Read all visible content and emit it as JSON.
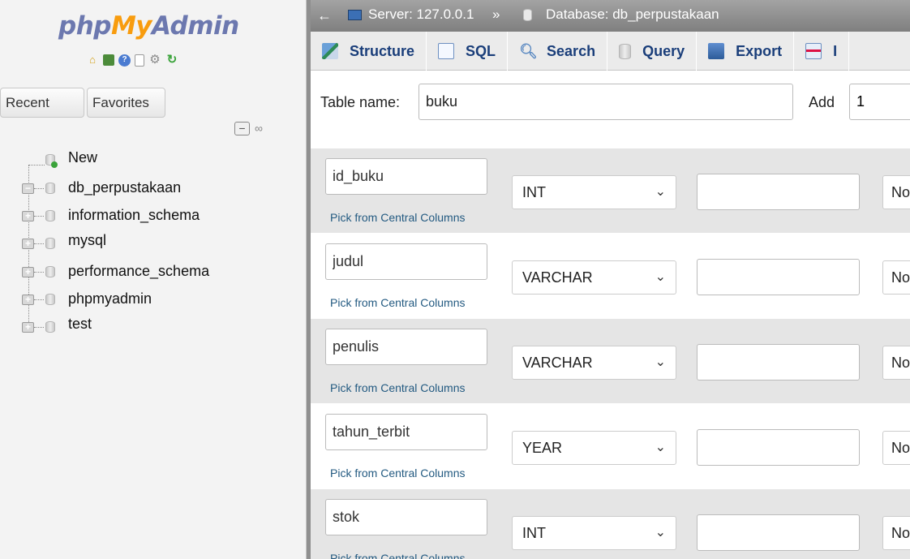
{
  "nav": {
    "logo": {
      "php": "php",
      "my": "My",
      "admin": "Admin"
    },
    "recent_label": "Recent",
    "favorites_label": "Favorites",
    "tree": [
      {
        "label": "New",
        "type": "new"
      },
      {
        "label": "db_perpustakaan",
        "type": "expanded"
      },
      {
        "label": "information_schema",
        "type": "collapsed"
      },
      {
        "label": "mysql",
        "type": "collapsed"
      },
      {
        "label": "performance_schema",
        "type": "collapsed"
      },
      {
        "label": "phpmyadmin",
        "type": "collapsed"
      },
      {
        "label": "test",
        "type": "collapsed"
      }
    ]
  },
  "breadcrumb": {
    "back": "←",
    "server": "Server: 127.0.0.1",
    "separator": "»",
    "database": "Database: db_perpustakaan"
  },
  "tabs": [
    {
      "label": "Structure",
      "icon": "structure-icon"
    },
    {
      "label": "SQL",
      "icon": "sql-icon"
    },
    {
      "label": "Search",
      "icon": "search-icon"
    },
    {
      "label": "Query",
      "icon": "query-icon"
    },
    {
      "label": "Export",
      "icon": "export-icon"
    },
    {
      "label": "I",
      "icon": "import-icon"
    }
  ],
  "form": {
    "table_name_label": "Table name:",
    "table_name_value": "buku",
    "add_label": "Add",
    "add_value": "1"
  },
  "columns": [
    {
      "name": "id_buku",
      "type": "INT",
      "default": "No",
      "pick": "Pick from Central Columns"
    },
    {
      "name": "judul",
      "type": "VARCHAR",
      "default": "No",
      "pick": "Pick from Central Columns"
    },
    {
      "name": "penulis",
      "type": "VARCHAR",
      "default": "No",
      "pick": "Pick from Central Columns"
    },
    {
      "name": "tahun_terbit",
      "type": "YEAR",
      "default": "No",
      "pick": "Pick from Central Columns"
    },
    {
      "name": "stok",
      "type": "INT",
      "default": "No",
      "pick": "Pick from Central Columns"
    }
  ],
  "colors": {
    "logo_blue": "#6c78af",
    "logo_orange": "#f89c0e",
    "link": "#235a81",
    "tab_text": "#1a3e7a"
  }
}
